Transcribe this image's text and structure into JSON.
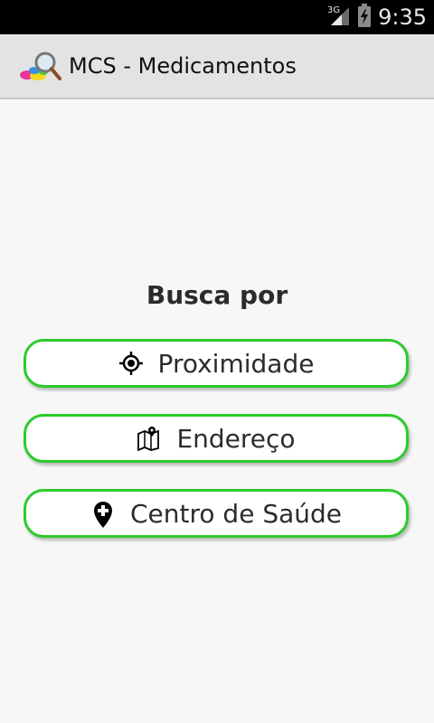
{
  "status_bar": {
    "network": "3G",
    "time": "9:35"
  },
  "action_bar": {
    "app_icon": "pills-magnifier-icon",
    "title": "MCS - Medicamentos"
  },
  "main": {
    "heading": "Busca por",
    "buttons": [
      {
        "icon": "target-location-icon",
        "label": "Proximidade"
      },
      {
        "icon": "map-pin-icon",
        "label": "Endereço"
      },
      {
        "icon": "health-pin-icon",
        "label": "Centro de Saúde"
      }
    ],
    "accent_color": "#2bcc2b"
  }
}
